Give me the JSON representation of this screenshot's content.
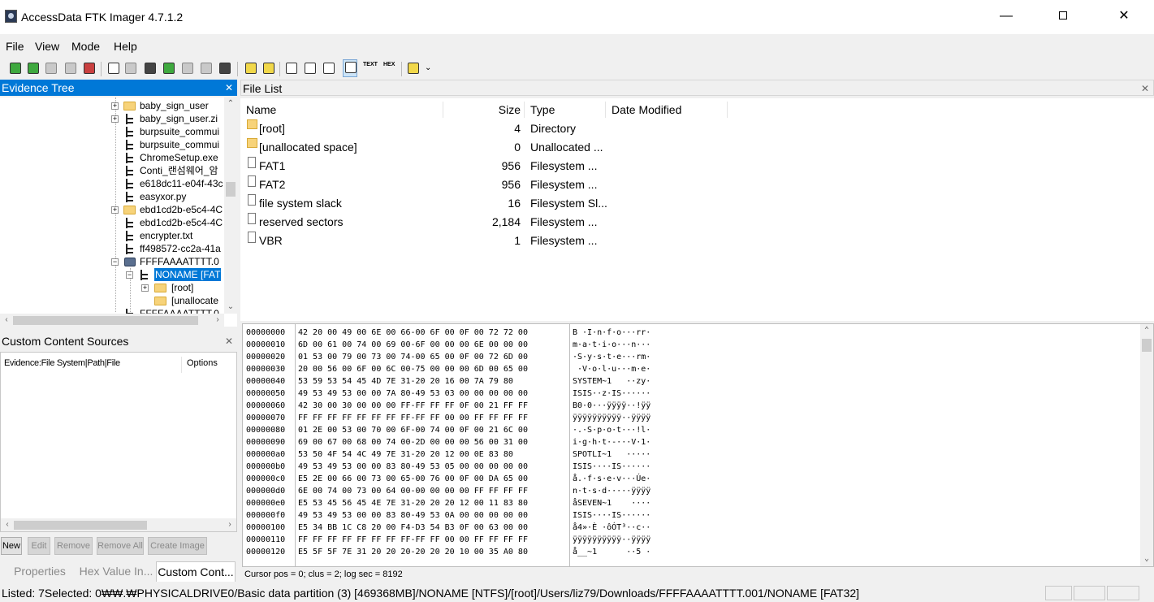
{
  "window": {
    "title": "AccessData FTK Imager 4.7.1.2",
    "min": "—",
    "close": "✕"
  },
  "menu": [
    "File",
    "View",
    "Mode",
    "Help"
  ],
  "toolbar": {
    "text_btn": "TEXT",
    "hex_btn": "HEX"
  },
  "evidence_tree": {
    "title": "Evidence Tree",
    "items": [
      "baby_sign_user",
      "baby_sign_user.zi",
      "burpsuite_commui",
      "burpsuite_commui",
      "ChromeSetup.exe",
      "Conti_랜섬웨어_암",
      "e618dc11-e04f-43c",
      "easyxor.py",
      "ebd1cd2b-e5c4-4C",
      "ebd1cd2b-e5c4-4C",
      "encrypter.txt",
      "ff498572-cc2a-41a",
      "FFFFAAAATTTT.0",
      "NONAME [FAT",
      "[root]",
      "[unallocate",
      "FFFFAAAATTTT.0"
    ]
  },
  "custom_content": {
    "title": "Custom Content Sources",
    "col_evidence": "Evidence:File System|Path|File",
    "col_options": "Options",
    "buttons": [
      "New",
      "Edit",
      "Remove",
      "Remove All",
      "Create Image"
    ]
  },
  "bottom_tabs": [
    "Properties",
    "Hex Value In...",
    "Custom Cont..."
  ],
  "file_list": {
    "title": "File List",
    "columns": [
      "Name",
      "Size",
      "Type",
      "Date Modified"
    ],
    "rows": [
      {
        "name": "[root]",
        "size": "4",
        "type": "Directory",
        "icon": "folder"
      },
      {
        "name": "[unallocated space]",
        "size": "0",
        "type": "Unallocated ...",
        "icon": "folder"
      },
      {
        "name": "FAT1",
        "size": "956",
        "type": "Filesystem ...",
        "icon": "file"
      },
      {
        "name": "FAT2",
        "size": "956",
        "type": "Filesystem ...",
        "icon": "file"
      },
      {
        "name": "file system slack",
        "size": "16",
        "type": "Filesystem Sl...",
        "icon": "file"
      },
      {
        "name": "reserved sectors",
        "size": "2,184",
        "type": "Filesystem ...",
        "icon": "file"
      },
      {
        "name": "VBR",
        "size": "1",
        "type": "Filesystem ...",
        "icon": "file"
      }
    ]
  },
  "hex": {
    "rows": [
      {
        "off": "00000000",
        "hex": "42 20 00 49 00 6E 00 66-00 6F 00 0F 00 72 72 00",
        "ascii": "B ·I·n·f·o···rr·"
      },
      {
        "off": "00000010",
        "hex": "6D 00 61 00 74 00 69 00-6F 00 00 00 6E 00 00 00",
        "ascii": "m·a·t·i·o···n···"
      },
      {
        "off": "00000020",
        "hex": "01 53 00 79 00 73 00 74-00 65 00 0F 00 72 6D 00",
        "ascii": "·S·y·s·t·e···rm·"
      },
      {
        "off": "00000030",
        "hex": "20 00 56 00 6F 00 6C 00-75 00 00 00 6D 00 65 00",
        "ascii": " ·V·o·l·u···m·e·"
      },
      {
        "off": "00000040",
        "hex": "53 59 53 54 45 4D 7E 31-20 20 16 00 7A 79 80",
        "ascii": "SYSTEM~1   ··zy·"
      },
      {
        "off": "00000050",
        "hex": "49 53 49 53 00 00 7A 80-49 53 03 00 00 00 00 00",
        "ascii": "ISIS··z·IS······"
      },
      {
        "off": "00000060",
        "hex": "42 30 00 30 00 00 00 FF-FF FF FF 0F 00 21 FF FF",
        "ascii": "B0·0···ÿÿÿÿ··!ÿÿ"
      },
      {
        "off": "00000070",
        "hex": "FF FF FF FF FF FF FF FF-FF FF 00 00 FF FF FF FF",
        "ascii": "ÿÿÿÿÿÿÿÿÿÿ··ÿÿÿÿ"
      },
      {
        "off": "00000080",
        "hex": "01 2E 00 53 00 70 00 6F-00 74 00 0F 00 21 6C 00",
        "ascii": "·.·S·p·o·t···!l·"
      },
      {
        "off": "00000090",
        "hex": "69 00 67 00 68 00 74 00-2D 00 00 00 56 00 31 00",
        "ascii": "i·g·h·t·-···V·1·"
      },
      {
        "off": "000000a0",
        "hex": "53 50 4F 54 4C 49 7E 31-20 20 12 00 0E 83 80",
        "ascii": "SPOTLI~1   ·····"
      },
      {
        "off": "000000b0",
        "hex": "49 53 49 53 00 00 83 80-49 53 05 00 00 00 00 00",
        "ascii": "ISIS····IS······"
      },
      {
        "off": "000000c0",
        "hex": "E5 2E 00 66 00 73 00 65-00 76 00 0F 00 DA 65 00",
        "ascii": "å.·f·s·e·v···Úe·"
      },
      {
        "off": "000000d0",
        "hex": "6E 00 74 00 73 00 64 00-00 00 00 00 FF FF FF FF",
        "ascii": "n·t·s·d·····ÿÿÿÿ"
      },
      {
        "off": "000000e0",
        "hex": "E5 53 45 56 45 4E 7E 31-20 20 20 12 00 11 83 80",
        "ascii": "åSEVEN~1    ····"
      },
      {
        "off": "000000f0",
        "hex": "49 53 49 53 00 00 83 80-49 53 0A 00 00 00 00 00",
        "ascii": "ISIS····IS······"
      },
      {
        "off": "00000100",
        "hex": "E5 34 BB 1C C8 20 00 F4-D3 54 B3 0F 00 63 00 00",
        "ascii": "å4»·È ·ôÓT³··c··"
      },
      {
        "off": "00000110",
        "hex": "FF FF FF FF FF FF FF FF-FF FF 00 00 FF FF FF FF",
        "ascii": "ÿÿÿÿÿÿÿÿÿÿ··ÿÿÿÿ"
      },
      {
        "off": "00000120",
        "hex": "E5 5F 5F 7E 31 20 20 20-20 20 20 10 00 35 A0 80",
        "ascii": "å__~1      ··5 ·"
      }
    ],
    "status": "Cursor pos = 0; clus = 2; log sec = 8192"
  },
  "status_bar": "Listed: 7Selected: 0₩₩.₩PHYSICALDRIVE0/Basic data partition (3) [469368MB]/NONAME [NTFS]/[root]/Users/liz79/Downloads/FFFFAAAATTTT.001/NONAME [FAT32]"
}
